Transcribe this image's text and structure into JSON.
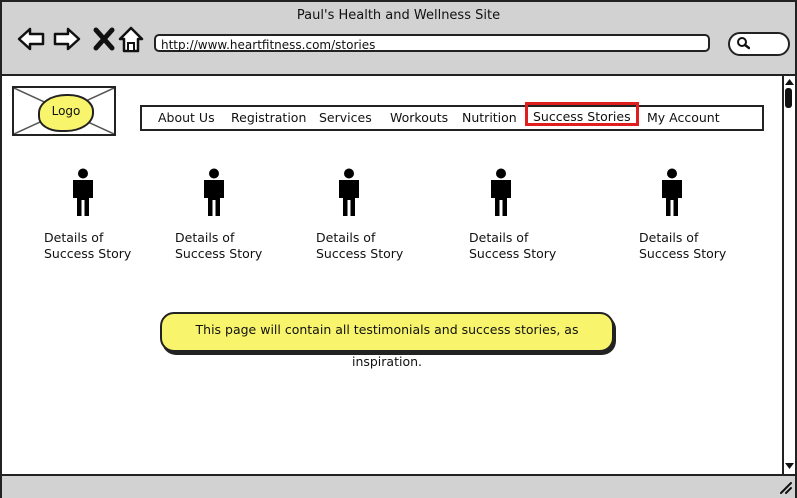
{
  "browser": {
    "title": "Paul's Health and Wellness Site",
    "url": "http://www.heartfitness.com/stories",
    "back_icon": "back-arrow-icon",
    "forward_icon": "forward-arrow-icon",
    "stop_icon": "close-icon",
    "home_icon": "home-icon",
    "search_icon": "search-icon"
  },
  "logo": {
    "label": "Logo"
  },
  "nav": {
    "items": [
      {
        "label": "About Us"
      },
      {
        "label": "Registration"
      },
      {
        "label": "Services"
      },
      {
        "label": "Workouts"
      },
      {
        "label": "Nutrition"
      },
      {
        "label": "Success Stories",
        "active": true
      },
      {
        "label": "My Account"
      }
    ],
    "active_color": "#e01e1e"
  },
  "stories": [
    {
      "line1": "Details of",
      "line2": "Success Story",
      "icon": "person-icon"
    },
    {
      "line1": "Details of",
      "line2": "Success Story",
      "icon": "person-icon"
    },
    {
      "line1": "Details of",
      "line2": "Success Story",
      "icon": "person-icon"
    },
    {
      "line1": "Details of",
      "line2": "Success Story",
      "icon": "person-icon"
    },
    {
      "line1": "Details of",
      "line2": "Success Story",
      "icon": "person-icon"
    }
  ],
  "note": {
    "text": "This page will contain all testimonials and success stories, as inspiration.",
    "color": "#f8f56c"
  }
}
